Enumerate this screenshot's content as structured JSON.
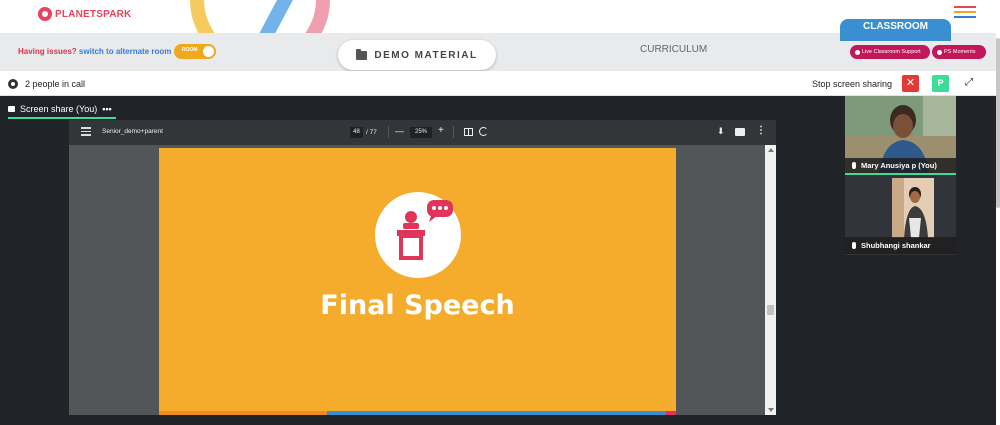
{
  "brand": {
    "name": "PLANETSPARK"
  },
  "header": {
    "classroom_tab": "CLASSROOM",
    "issues_text": "Having issues?",
    "issues_link": "switch to alternate room",
    "toggle_label": "ROOM",
    "demo_material": "DEMO MATERIAL",
    "curriculum": "CURRICULUM",
    "live_support": "Live Classroom Support",
    "ps_moments": "PS Moments"
  },
  "call": {
    "people_count": "2 people in call",
    "stop_share": "Stop screen sharing",
    "close_glyph": "✕",
    "p_badge": "P",
    "expand_glyph": "⤢"
  },
  "share": {
    "tab_label": "Screen share (You)",
    "more": "•••"
  },
  "pdf": {
    "file_name": "Senior_demo+parent",
    "page": "48",
    "total": "/ 77",
    "zoom": "25%",
    "minus": "—",
    "plus": "+",
    "download": "⬇",
    "more": "⋮"
  },
  "slide": {
    "title": "Final Speech",
    "bg": "#f5ab2b"
  },
  "participants": [
    {
      "name": "Mary Anusiya p (You)"
    },
    {
      "name": "Shubhangi shankar"
    }
  ],
  "colors": {
    "accent_green": "#3ddc97",
    "brand_red": "#e8435d",
    "pill_magenta": "#c2185b",
    "classroom_blue": "#3a8fd1"
  }
}
